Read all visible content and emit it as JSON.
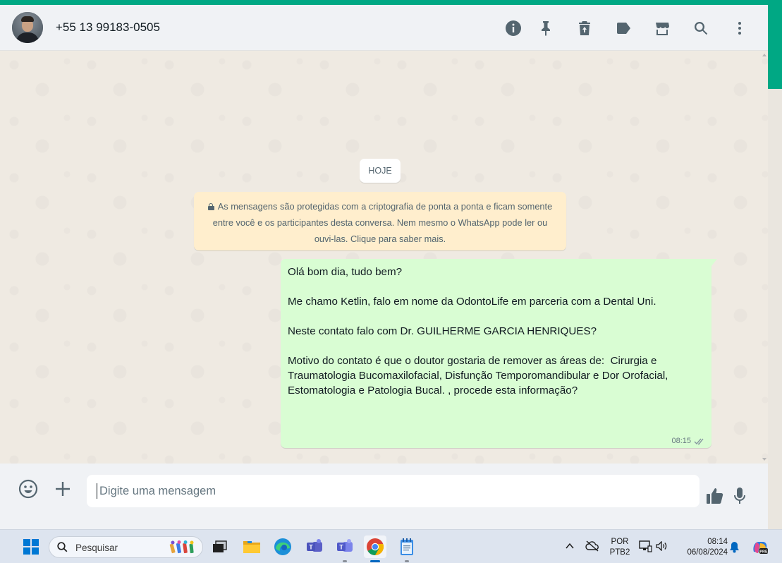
{
  "chat": {
    "contact_name": "+55 13 99183-0505",
    "date_chip": "HOJE",
    "encryption_notice": "As mensagens são protegidas com a criptografia de ponta a ponta e ficam somente entre você e os participantes desta conversa. Nem mesmo o WhatsApp pode ler ou ouvi-las. Clique para saber mais.",
    "messages": [
      {
        "direction": "outgoing",
        "text": "Olá bom dia, tudo bem?\n\nMe chamo Ketlin, falo em nome da OdontoLife em parceria com a Dental Uni.\n\nNeste contato falo com Dr. GUILHERME GARCIA HENRIQUES?\n\nMotivo do contato é que o doutor gostaria de remover as áreas de:  Cirurgia e Traumatologia Bucomaxilofacial, Disfunção Temporomandibular e Dor Orofacial, Estomatologia e Patologia Bucal. , procede esta informação?",
        "time": "08:15",
        "status": "delivered"
      }
    ]
  },
  "header_icons": [
    "info-icon",
    "pin-icon",
    "trash-icon",
    "label-icon",
    "catalog-icon",
    "search-icon",
    "menu-icon"
  ],
  "composer": {
    "placeholder": "Digite uma mensagem"
  },
  "taskbar": {
    "search_placeholder": "Pesquisar",
    "language": "POR",
    "layout": "PTB2",
    "time": "08:14",
    "date": "06/08/2024",
    "apps": [
      "windows-start",
      "file-explorer",
      "folder",
      "edge",
      "teams-work",
      "teams",
      "chrome",
      "notepad"
    ]
  },
  "colors": {
    "accent": "#00a884",
    "outgoing_bubble": "#d9fdd3",
    "notice_bg": "#ffeecd",
    "chat_bg": "#efeae2",
    "header_bg": "#f0f2f5",
    "icon_gray": "#54656f"
  }
}
